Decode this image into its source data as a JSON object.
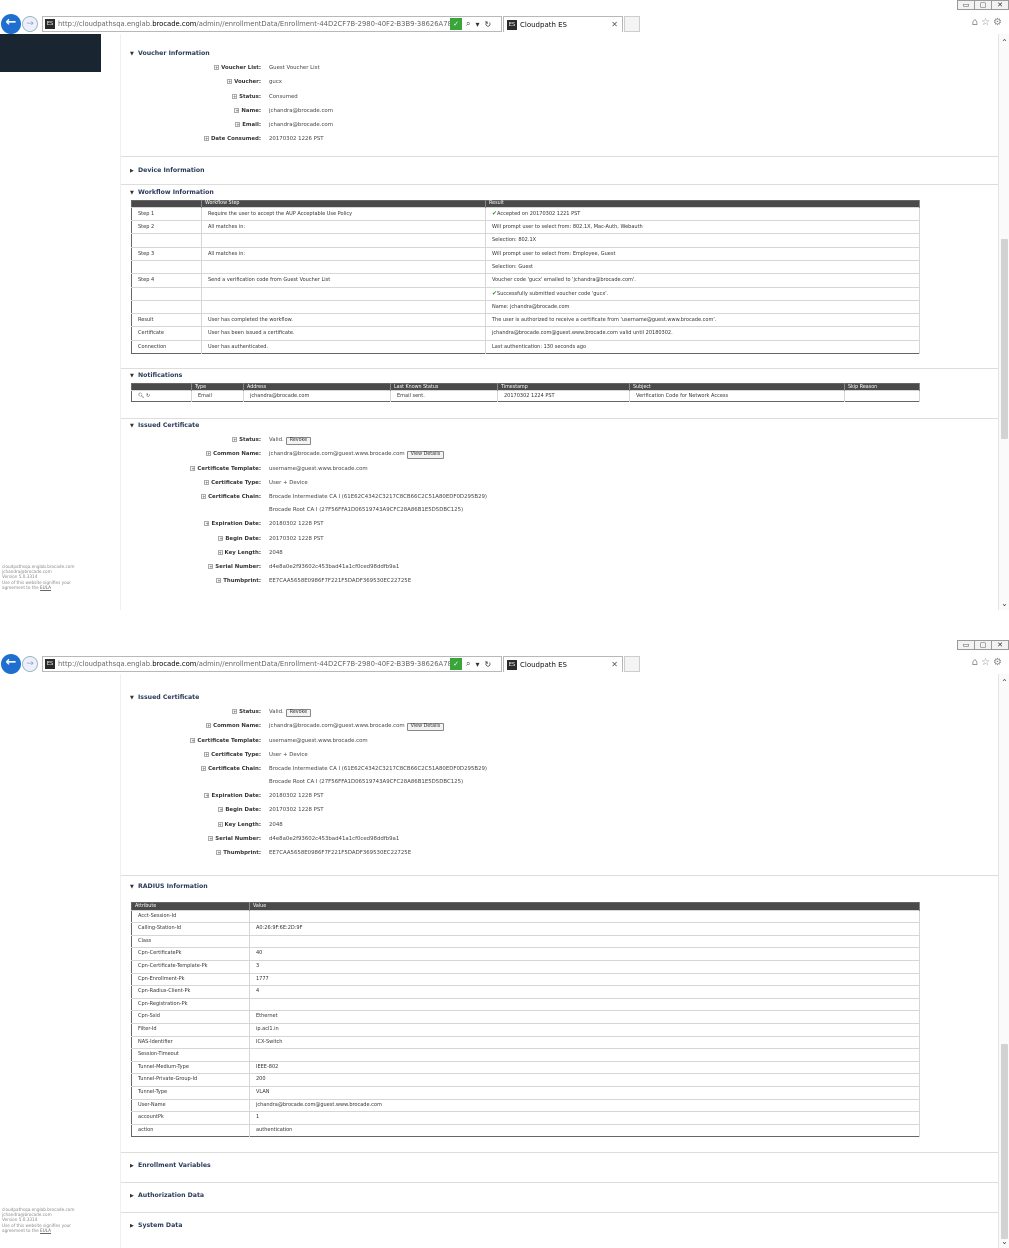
{
  "browser": {
    "url_prefix": "http://cloudpathsqa.englab.",
    "url_domain": "brocade.com",
    "url_suffix": "/admin//enrollmentData/Enrollment-44D2CF7B-2980-40F2-B3B9-38626A78A7F4/v",
    "tab_title": "Cloudpath ES",
    "window_controls": [
      "▭",
      "▢",
      "✕"
    ]
  },
  "footer": {
    "line1": "cloudpathsqa.englab.brocade.com",
    "line2": "jchandra@brocade.com",
    "line3": "Version 5.0.3314",
    "line4": "Use of this website signifies your",
    "line5_pre": "agreement to the ",
    "line5_link": "EULA"
  },
  "voucher": {
    "title": "Voucher Information",
    "rows": [
      {
        "k": "Voucher List:",
        "v": "Guest Voucher List"
      },
      {
        "k": "Voucher:",
        "v": "gucx"
      },
      {
        "k": "Status:",
        "v": "Consumed"
      },
      {
        "k": "Name:",
        "v": "jchandra@brocade.com"
      },
      {
        "k": "Email:",
        "v": "jchandra@brocade.com"
      },
      {
        "k": "Date Consumed:",
        "v": "20170302 1226 PST"
      }
    ]
  },
  "device": {
    "title": "Device Information"
  },
  "workflow": {
    "title": "Workflow Information",
    "col_step": "Workflow Step",
    "col_result": "Result",
    "rows": [
      {
        "label": "Step 1",
        "step": "Require the user to accept the AUP Acceptable Use Policy",
        "result": "Accepted on 20170302 1221 PST",
        "check": "✔"
      },
      {
        "label": "Step 2",
        "step": "All matches in:",
        "result": "Will prompt user to select from: 802.1X, Mac-Auth, Webauth",
        "check": ""
      },
      {
        "label": "",
        "step": "",
        "result": "Selection: 802.1X",
        "check": ""
      },
      {
        "label": "Step 3",
        "step": "All matches in:",
        "result": "Will prompt user to select from: Employee, Guest",
        "check": ""
      },
      {
        "label": "",
        "step": "",
        "result": "Selection: Guest",
        "check": ""
      },
      {
        "label": "Step 4",
        "step": "Send a verification code from Guest Voucher List",
        "result": "Voucher code 'gucx' emailed to 'jchandra@brocade.com'.",
        "check": ""
      },
      {
        "label": "",
        "step": "",
        "result": "Successfully submitted voucher code 'gucx'.",
        "check": "✔"
      },
      {
        "label": "",
        "step": "",
        "result": "Name: jchandra@brocade.com",
        "check": ""
      },
      {
        "label": "Result",
        "step": "User has completed the workflow.",
        "result": "The user is authorized to receive a certificate from 'username@guest.www.brocade.com'.",
        "check": ""
      },
      {
        "label": "Certificate",
        "step": "User has been issued a certificate.",
        "result": "jchandra@brocade.com@guest.www.brocade.com valid until 20180302.",
        "check": ""
      },
      {
        "label": "Connection",
        "step": "User has authenticated.",
        "result": "Last authentication: 130 seconds ago",
        "check": ""
      }
    ]
  },
  "notifications": {
    "title": "Notifications",
    "cols": [
      "Type",
      "Address",
      "Last Known Status",
      "Timestamp",
      "Subject",
      "Skip Reason"
    ],
    "row": [
      "Email",
      "jchandra@brocade.com",
      "Email sent.",
      "20170302 1224 PST",
      "Verification Code for Network Access",
      ""
    ]
  },
  "certificate": {
    "title": "Issued Certificate",
    "revoke": "Revoke",
    "view_details": "View Details",
    "rows": [
      {
        "k": "Status:",
        "v": "Valid."
      },
      {
        "k": "Common Name:",
        "v": "jchandra@brocade.com@guest.www.brocade.com"
      },
      {
        "k": "Certificate Template:",
        "v": "username@guest.www.brocade.com"
      },
      {
        "k": "Certificate Type:",
        "v": "User + Device"
      },
      {
        "k": "Certificate Chain:",
        "v": "Brocade Intermediate CA I (61E62C4342C3217C8CB66C2C51A80EDF0D295B29)"
      },
      {
        "k": "",
        "v": "Brocade Root CA I (27F56FFA1D06519743A9CFC28A86B1E5D5DBC125)"
      },
      {
        "k": "Expiration Date:",
        "v": "20180302 1228 PST"
      },
      {
        "k": "Begin Date:",
        "v": "20170302 1228 PST"
      },
      {
        "k": "Key Length:",
        "v": "2048"
      },
      {
        "k": "Serial Number:",
        "v": "d4e8a0e2f93602c453bad41a1cf0ced98ddfb9a1"
      },
      {
        "k": "Thumbprint:",
        "v": "EE7CAA5658E0986F7F221F5DADF369530EC22725E"
      }
    ]
  },
  "radius": {
    "title": "RADIUS Information",
    "col_attr": "Attribute",
    "col_value": "Value",
    "rows": [
      [
        "Acct-Session-Id",
        ""
      ],
      [
        "Calling-Station-Id",
        "A0:26:9F:6E:2D:9F"
      ],
      [
        "Class",
        ""
      ],
      [
        "Cpn-CertificatePk",
        "40"
      ],
      [
        "Cpn-Certificate-Template-Pk",
        "3"
      ],
      [
        "Cpn-Enrollment-Pk",
        "1777"
      ],
      [
        "Cpn-Radius-Client-Pk",
        "4"
      ],
      [
        "Cpn-Registration-Pk",
        ""
      ],
      [
        "Cpn-Ssid",
        "Ethernet"
      ],
      [
        "Filter-Id",
        "ip.acl1.in"
      ],
      [
        "NAS-Identifier",
        "ICX-Switch"
      ],
      [
        "Session-Timeout",
        ""
      ],
      [
        "Tunnel-Medium-Type",
        "IEEE-802"
      ],
      [
        "Tunnel-Private-Group-Id",
        "200"
      ],
      [
        "Tunnel-Type",
        "VLAN"
      ],
      [
        "User-Name",
        "jchandra@brocade.com@guest.www.brocade.com"
      ],
      [
        "accountPk",
        "1"
      ],
      [
        "action",
        "authentication"
      ]
    ]
  },
  "enrollment_vars": {
    "title": "Enrollment Variables"
  },
  "authorization": {
    "title": "Authorization Data"
  },
  "system": {
    "title": "System Data"
  }
}
